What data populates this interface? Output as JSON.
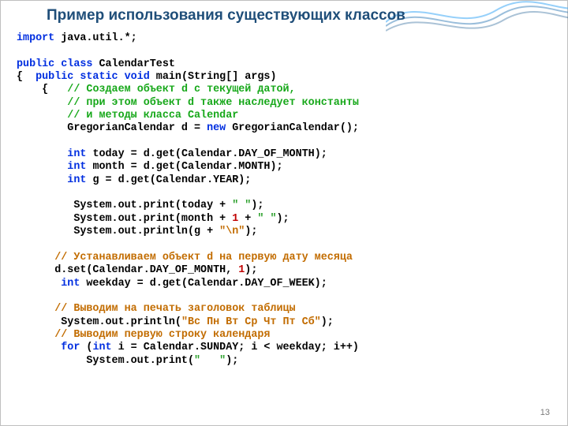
{
  "slide": {
    "title": "Пример использования существующих классов",
    "page_number": "13"
  },
  "c": {
    "import_kw": "import",
    "import_rest": " java.util.*;",
    "l3a": "public class",
    "l3b": " CalendarTest",
    "l4a": "{  ",
    "l4b": "public static void",
    "l4c": " main(String[] args)",
    "l5a": "    {   ",
    "l5b": "// Создаем объект d с текущей датой,",
    "l6a": "        ",
    "l6b": "// при этом объект d также наследует константы",
    "l7a": "        ",
    "l7b": "// и методы класса Calendar",
    "l8a": "        GregorianCalendar d = ",
    "l8b": "new",
    "l8c": " GregorianCalendar();",
    "l10a": "        ",
    "l10b": "int",
    "l10c": " today = d.get(Calendar.DAY_OF_MONTH);",
    "l11a": "        ",
    "l11b": "int",
    "l11c": " month = d.get(Calendar.MONTH);",
    "l12a": "        ",
    "l12b": "int",
    "l12c": " g = d.get(Calendar.YEAR);",
    "l14": "         System.out.print(today + ",
    "l14s": "\" \"",
    "l14e": ");",
    "l15": "         System.out.print(month + ",
    "l15n": "1",
    "l15m": " + ",
    "l15s": "\" \"",
    "l15e": ");",
    "l16": "         System.out.println(g + ",
    "l16s": "\"\\n\"",
    "l16e": ");",
    "l18a": "      ",
    "l18b": "// Устанавливаем объект d на первую дату месяца",
    "l19a": "      d.set(Calendar.DAY_OF_MONTH, ",
    "l19n": "1",
    "l19e": ");",
    "l20a": "       ",
    "l20b": "int",
    "l20c": " weekday = d.get(Calendar.DAY_OF_WEEK);",
    "l22a": "      ",
    "l22b": "// Выводим на печать заголовок таблицы",
    "l23a": "       System.out.println(",
    "l23s": "\"Вс Пн Вт Ср Чт Пт Сб\"",
    "l23e": ");",
    "l24a": "      ",
    "l24b": "// Выводим первую строку календаря",
    "l25a": "       ",
    "l25b": "for",
    "l25c": " (",
    "l25d": "int",
    "l25e": " i = Calendar.SUNDAY; i < weekday; i++)",
    "l26a": "           System.out.print(",
    "l26s": "\"   \"",
    "l26e": ");"
  }
}
